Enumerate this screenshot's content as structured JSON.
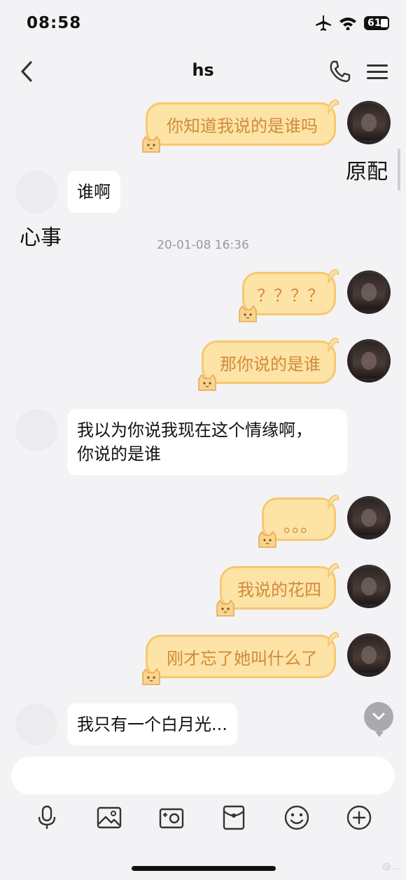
{
  "status_bar": {
    "time": "08:58",
    "battery": "61"
  },
  "nav": {
    "title": "hs"
  },
  "messages": {
    "m1": "你知道我说的是谁吗",
    "m1_side": "原配",
    "m2": "谁啊",
    "m2_side": "心事",
    "timestamp": "20-01-08 16:36",
    "m3": "？？？？",
    "m4": "那你说的是谁",
    "m5_line1": "我以为你说我现在这个情缘啊，",
    "m5_line2": "你说的是谁",
    "m6": "。。。",
    "m7": "我说的花四",
    "m8": "刚才忘了她叫什么了",
    "m9": "我只有一个白月光..."
  },
  "input": {
    "placeholder": ""
  },
  "toolbar": [
    "microphone-icon",
    "image-icon",
    "camera-icon",
    "red-packet-icon",
    "emoji-icon",
    "plus-icon"
  ],
  "watermark": "@...",
  "colors": {
    "cat_bubble_fill": "#fde3a6",
    "cat_bubble_border": "#f6c870",
    "cat_text": "#d08b3b",
    "background": "#f3f3f5"
  }
}
